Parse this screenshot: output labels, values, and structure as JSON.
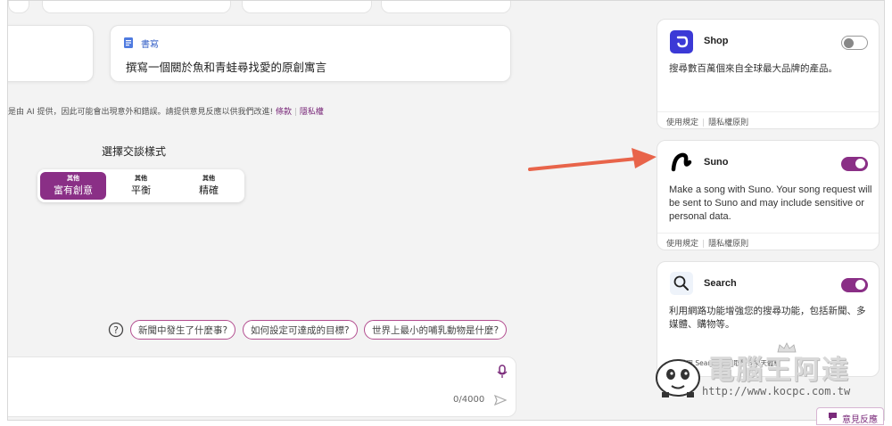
{
  "compose_card": {
    "label": "書寫",
    "text": "撰寫一個關於魚和青蛙尋找愛的原創寓言"
  },
  "disclaimer": {
    "text": "是由 AI 提供，因此可能會出現意外和錯誤。請提供意見反應以供我們改進!",
    "terms": "條款",
    "privacy": "隱私權"
  },
  "style_picker": {
    "title": "選擇交談樣式",
    "options": [
      {
        "more": "其他",
        "label": "富有創意",
        "active": true
      },
      {
        "more": "其他",
        "label": "平衡",
        "active": false
      },
      {
        "more": "其他",
        "label": "精確",
        "active": false
      }
    ]
  },
  "suggestions": [
    "新聞中發生了什麼事?",
    "如何設定可達成的目標?",
    "世界上最小的哺乳動物是什麼?"
  ],
  "input": {
    "counter": "0/4000"
  },
  "plugins": [
    {
      "name": "Shop",
      "enabled": false,
      "desc": "搜尋數百萬個來自全球最大品牌的產品。",
      "terms": "使用規定",
      "privacy": "隱私權原則"
    },
    {
      "name": "Suno",
      "enabled": true,
      "desc": "Make a song with Suno. Your song request will be sent to Suno and may include sensitive or personal data.",
      "terms": "使用規定",
      "privacy": "隱私權原則"
    },
    {
      "name": "Search",
      "enabled": true,
      "desc": "利用網路功能增強您的搜尋功能，包括新聞、多媒體、購物等。",
      "footer": "一律啟用 Search 以獲取最佳聊天體驗"
    }
  ],
  "watermark": {
    "main": "電腦王阿達",
    "url": "http://www.kocpc.com.tw"
  },
  "feedback": {
    "label": "意見反應"
  },
  "colors": {
    "accent": "#8a2f86",
    "arrow": "#e8644a",
    "chip_border": "#b34d8f"
  }
}
